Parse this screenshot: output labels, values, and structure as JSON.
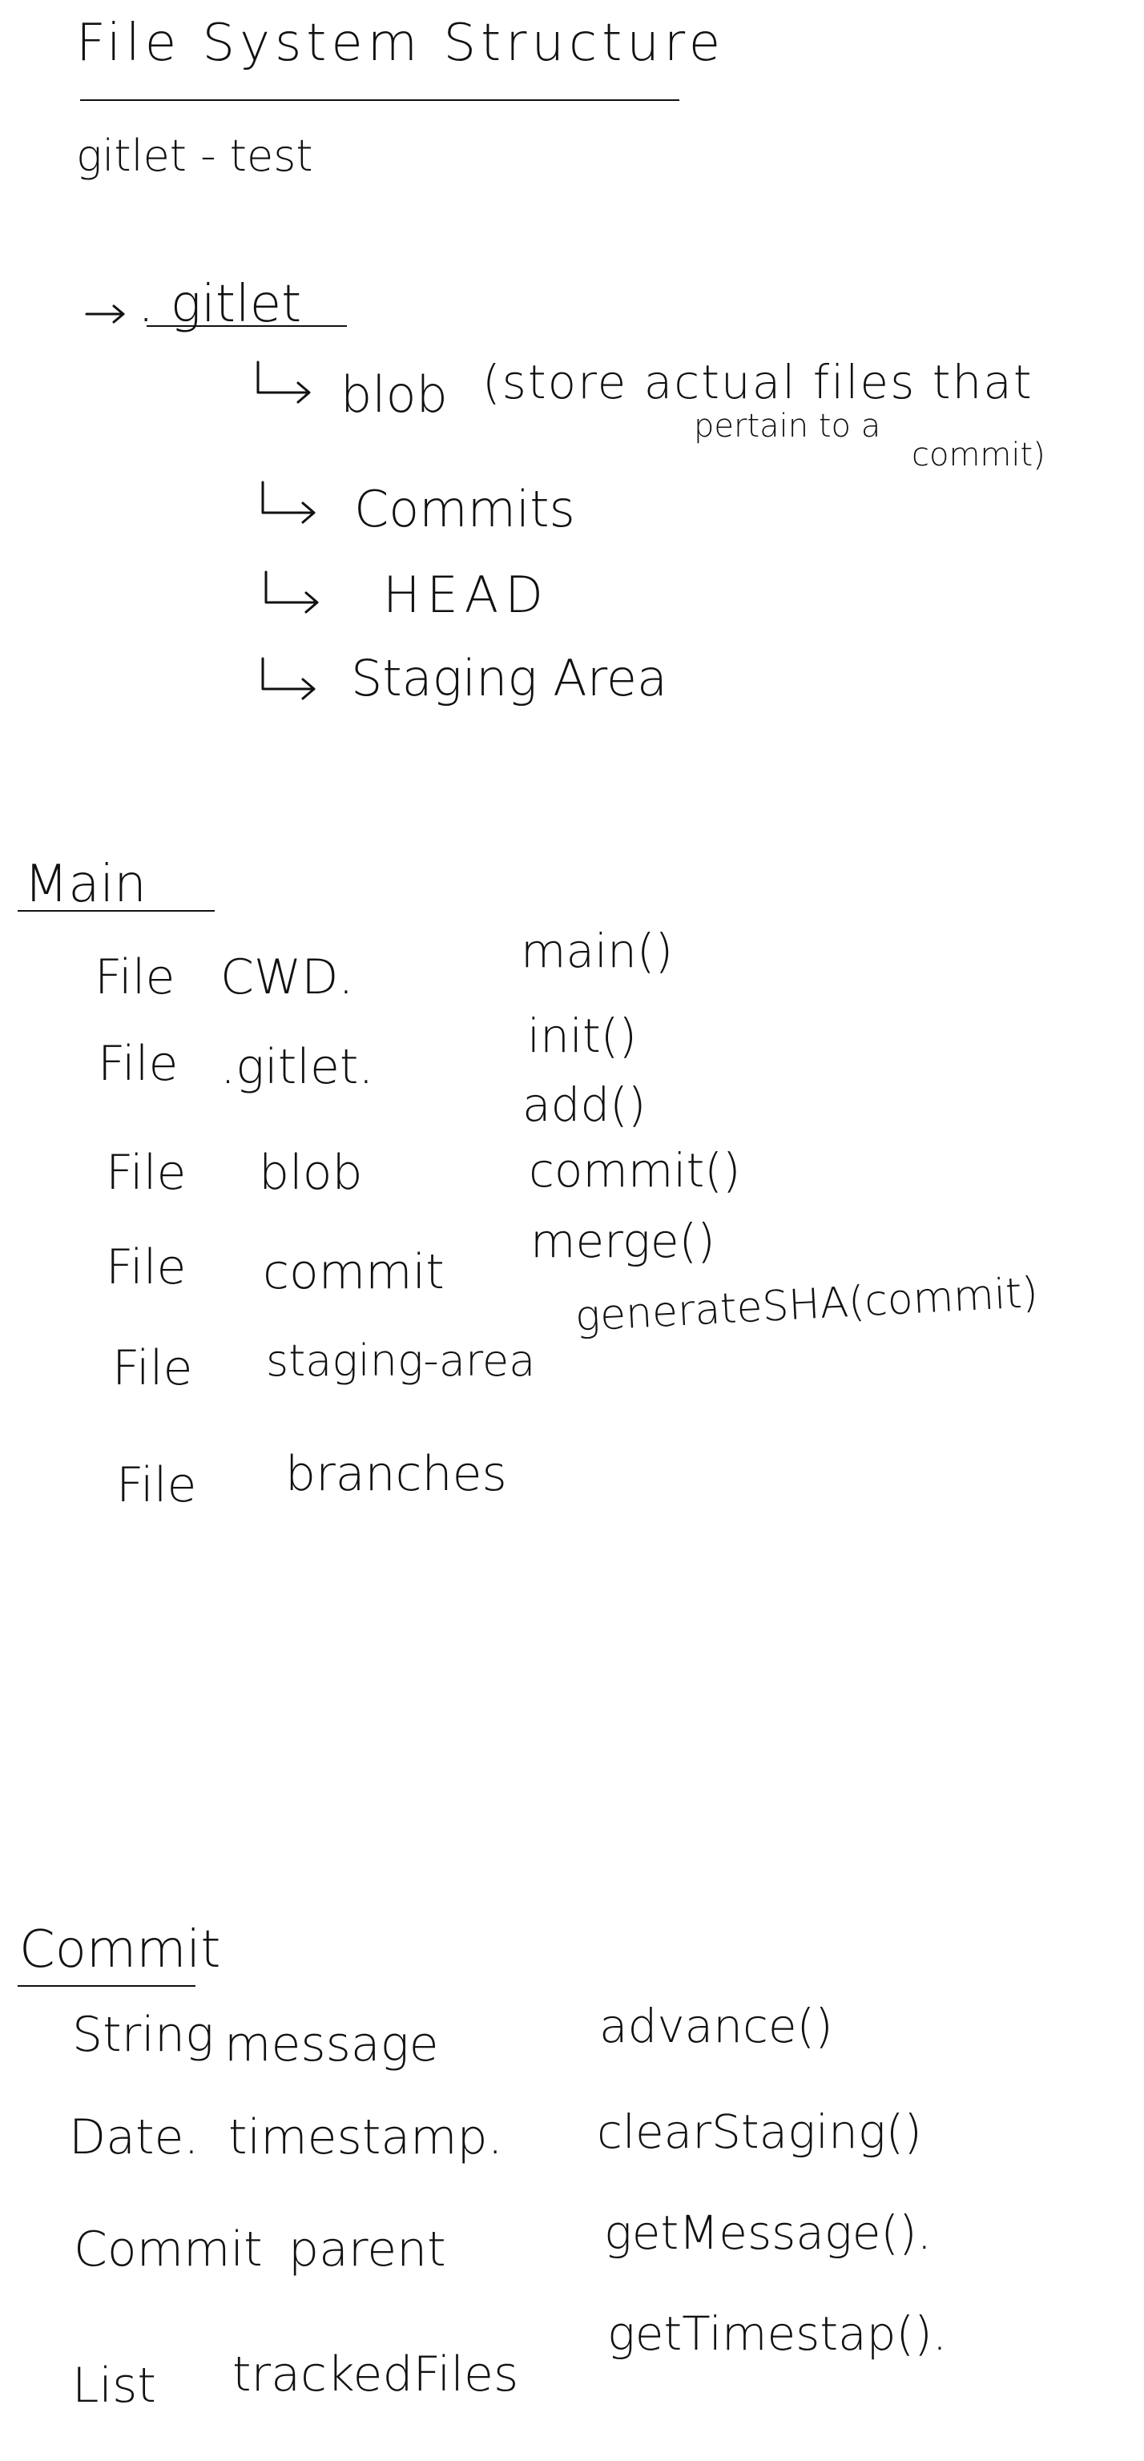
{
  "file_system": {
    "title": "File System Structure",
    "root": "gitlet - test",
    "gitlet_dir": ". gitlet",
    "children": [
      {
        "name": "blob",
        "note": "(store actual files that",
        "note2": "pertain to a",
        "note3": "commit)"
      },
      {
        "name": "Commits"
      },
      {
        "name": "HEAD"
      },
      {
        "name": "Staging Area"
      }
    ]
  },
  "main_class": {
    "title": "Main",
    "fields": [
      {
        "type": "File",
        "name": "CWD."
      },
      {
        "type": "File",
        "name": ".gitlet."
      },
      {
        "type": "File",
        "name": "blob"
      },
      {
        "type": "File",
        "name": "commit"
      },
      {
        "type": "File",
        "name": "staging-area"
      },
      {
        "type": "File",
        "name": "branches"
      }
    ],
    "methods": [
      "main()",
      "init()",
      "add()",
      "commit()",
      "merge()",
      "generateSHA(commit)"
    ]
  },
  "commit_class": {
    "title": "Commit",
    "fields": [
      {
        "type": "String",
        "name": "message"
      },
      {
        "type": "Date.",
        "name": "timestamp."
      },
      {
        "type": "Commit",
        "name": "parent"
      },
      {
        "type": "List",
        "name": "trackedFiles"
      }
    ],
    "methods": [
      "advance()",
      "clearStaging()",
      "getMessage().",
      "getTimestap()."
    ]
  }
}
